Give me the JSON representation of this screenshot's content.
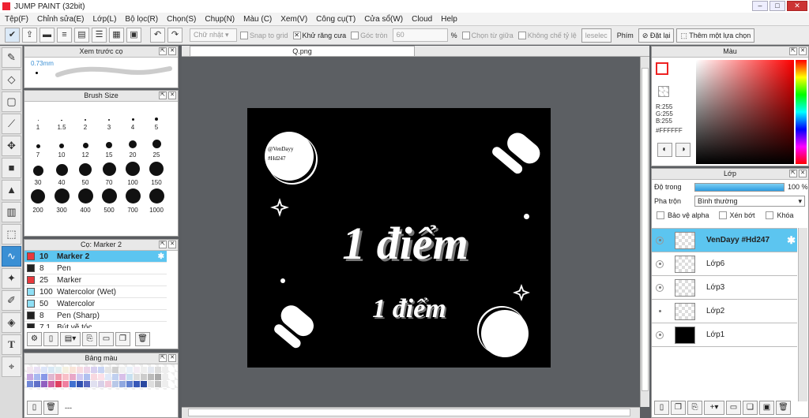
{
  "app": {
    "title": "JUMP PAINT (32bit)",
    "win_buttons": [
      "–",
      "□",
      "✕"
    ]
  },
  "menu": [
    "Tệp(F)",
    "Chỉnh sửa(E)",
    "Lớp(L)",
    "Bộ lọc(R)",
    "Chọn(S)",
    "Chụp(N)",
    "Màu (C)",
    "Xem(V)",
    "Công cụ(T)",
    "Cửa sổ(W)",
    "Cloud",
    "Help"
  ],
  "toolbar": {
    "shape": "Chữ nhật",
    "snap": "Snap to grid",
    "antialias": "Khử răng cưa",
    "round": "Góc tròn",
    "round_value": "60",
    "pct": "%",
    "select_middle": "Chọn từ giữa",
    "no_scale": "Không chế tỷ lệ",
    "select_label": "leselec",
    "hotkey": "Phím",
    "reset": "Đặt lại",
    "add_sel": "Thêm một lựa chọn"
  },
  "preview": {
    "title": "Xem trước cọ",
    "size": "0.73mm"
  },
  "brush_size": {
    "title": "Brush Size",
    "sizes": [
      "1",
      "1.5",
      "2",
      "3",
      "4",
      "5",
      "7",
      "10",
      "12",
      "15",
      "20",
      "25",
      "30",
      "40",
      "50",
      "70",
      "100",
      "150",
      "200",
      "300",
      "400",
      "500",
      "700",
      "1000"
    ]
  },
  "brush_list": {
    "title": "Cọ: Marker 2",
    "items": [
      {
        "size": "10",
        "name": "Marker 2",
        "color": "#e8383c"
      },
      {
        "size": "8",
        "name": "Pen",
        "color": "#222222"
      },
      {
        "size": "25",
        "name": "Marker",
        "color": "#e8383c"
      },
      {
        "size": "100",
        "name": "Watercolor (Wet)",
        "color": "#8fdff5"
      },
      {
        "size": "50",
        "name": "Watercolor",
        "color": "#8fdff5"
      },
      {
        "size": "8",
        "name": "Pen (Sharp)",
        "color": "#222222"
      },
      {
        "size": "7.1",
        "name": "Bút vẽ tóc",
        "color": "#222222"
      }
    ]
  },
  "palette": {
    "title": "Bảng màu",
    "footer": "---"
  },
  "canvas": {
    "tab": "Q.png",
    "handle": "@VenDayy\n#Hd247",
    "text_big": "1 điểm",
    "text_small": "1 điểm"
  },
  "color_panel": {
    "title": "Màu",
    "r": "R:255",
    "g": "G:255",
    "b": "B:255",
    "hex": "#FFFFFF"
  },
  "layer_panel": {
    "title": "Lớp",
    "opacity_label": "Độ trong",
    "opacity_value": "100 %",
    "opacity_level": 1.0,
    "blend_label": "Pha trộn",
    "blend_value": "Bình thường",
    "protect_alpha": "Bảo vệ alpha",
    "clip": "Xén bớt",
    "lock": "Khóa",
    "layers": [
      "VenDayy #Hd247",
      "Lớp6",
      "Lớp3",
      "Lớp2",
      "Lớp1"
    ]
  },
  "colors": {
    "accent": "#5cc5f0",
    "selected_tool": "#3a8fd4"
  }
}
